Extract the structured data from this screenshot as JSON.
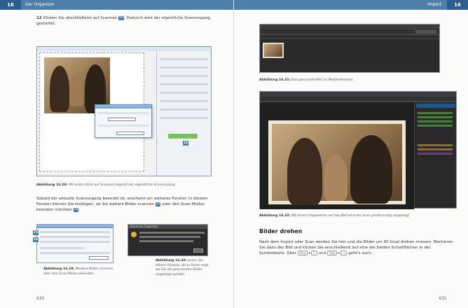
{
  "left_page": {
    "chapter_number": "16",
    "chapter_title": "Der Organizer",
    "step_number": "12",
    "step_text_1": "Klicken Sie abschließend auf Scannen",
    "step_callout_1": "14",
    "step_text_2": ". Dadurch wird der eigentliche Scanvorgang gestartet.",
    "fig_28_label": "Abbildung 16.28:",
    "fig_28_caption": "Mit einem Klick auf Scannen beginnt der eigentliche Scanvorgang.",
    "para_1a": "Sobald der aktuelle Scanvorgang beendet ist, erscheint ein weiteres Fenster. In diesem Fenster können Sie festlegen, ob Sie weitere Bilder scannen",
    "para_1_callout_a": "15",
    "para_1b": "oder den Scan-Modus beenden möchten",
    "para_1_callout_b": "16",
    "fig_29_label": "Abbildung 16.29:",
    "fig_29_caption": "Weitere Bilder scannen oder den Scan-Modus beenden.",
    "fig_30_label": "Abbildung 16.30:",
    "fig_30_caption": "Lesen Sie diesen Hinweis, da er Ihnen sagt, wo Sie die gescannten Bilder angezeigt werden.",
    "dialog_title": "Elements Organizer",
    "page_number": "630"
  },
  "right_page": {
    "chapter_label": "Import",
    "chapter_number": "16",
    "fig_31_label": "Abbildung 16.31:",
    "fig_31_caption": "Das gescannte Bild im Medienbrowser.",
    "fig_32_label": "Abbildung 16.32:",
    "fig_32_caption": "Mit einem Doppelklick auf das Bild wird der Scan großformatig angezeigt.",
    "section_heading": "Bilder drehen",
    "section_text_1": "Nach dem Import oder Scan werden Sie hier und die Bilder um 90 Grad drehen müssen. Markieren Sie dazu das Bild und klicken Sie anschließend auf eine der beiden Schaltflächen in der Symbolleiste. Über",
    "key_1": "Strg",
    "key_2": "←",
    "key_3": "Strg",
    "key_4": "→",
    "and_text": "und",
    "section_text_2": "geht's auch.",
    "page_number": "631"
  }
}
